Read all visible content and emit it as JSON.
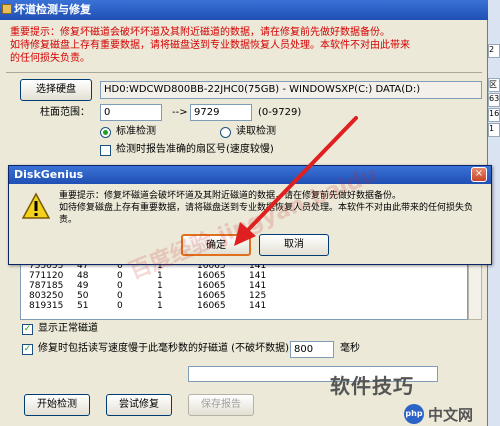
{
  "main_window": {
    "title": "坏道检测与修复",
    "warning_line1": "重要提示：修复坏磁道会破坏坏道及其附近磁道的数据，请在修复前先做好数据备份。",
    "warning_line2": "如待修复磁盘上存有重要数据，请将磁盘送到专业数据恢复人员处理。本软件不对由此带来",
    "warning_line3": "的任何损失负责。",
    "select_disk_button": "选择硬盘",
    "disk_info": "HD0:WDCWD800BB-22JHC0(75GB) - WINDOWSXP(C:) DATA(D:)",
    "cylinder_range_label": "柱面范围：",
    "cylinder_from": "0",
    "range_arrow": "-->",
    "cylinder_to": "9729",
    "cylinder_hint": "(0-9729)",
    "radio_standard": "标准检测",
    "radio_read": "读取检测",
    "check_report_lba": "检测时报告准确的扇区号(速度较慢)",
    "show_normal_tracks": "显示正常磁道",
    "repair_slow_tracks": "修复时包括读写速度慢于此毫秒数的好磁道 (不破坏数据)：",
    "slow_ms_value": "800",
    "slow_ms_unit": "毫秒",
    "start_button": "开始检测",
    "try_repair_button": "尝试修复",
    "save_report_button": "保存报告"
  },
  "table": {
    "rows": [
      [
        "755055",
        "47",
        "0",
        "1",
        "16065",
        "141"
      ],
      [
        "771120",
        "48",
        "0",
        "1",
        "16065",
        "141"
      ],
      [
        "787185",
        "49",
        "0",
        "1",
        "16065",
        "141"
      ],
      [
        "803250",
        "50",
        "0",
        "1",
        "16065",
        "125"
      ],
      [
        "819315",
        "51",
        "0",
        "1",
        "16065",
        "141"
      ]
    ]
  },
  "dialog": {
    "title": "DiskGenius",
    "message_line1": "重要提示：修复坏磁道会破坏坏道及其附近磁道的数据，请在修复前先做好数据备份。",
    "message_line2": "如待修复磁盘上存有重要数据，请将磁盘送到专业数据恢复人员处理。本软件不对由此带来的任何损失负",
    "message_line3": "责。",
    "ok_button": "确定",
    "cancel_button": "取消",
    "close_glyph": "×"
  },
  "background_app": {
    "cells": [
      "2",
      "区",
      "63",
      "16",
      "1"
    ]
  },
  "overlay": {
    "watermark": "百度经验 jingyan.baidu",
    "brand_text": "软件技巧",
    "php_badge": "php",
    "php_site": "中文网"
  },
  "colors": {
    "warning_red": "#d40000",
    "title_blue": "#1f4fb4",
    "arrow_red": "#e02020"
  },
  "icons": {
    "dialog_icon": "warning-triangle-icon",
    "main_icon": "app-icon"
  }
}
